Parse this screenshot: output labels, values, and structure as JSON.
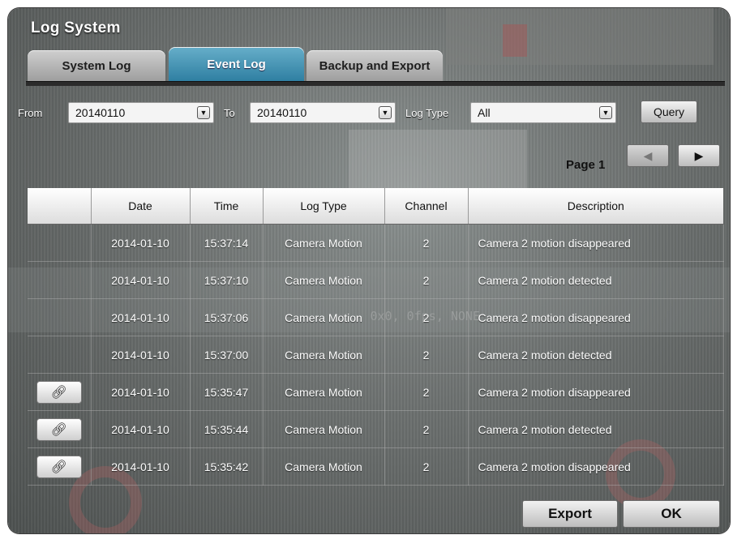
{
  "window": {
    "title": "Log System"
  },
  "tabs": [
    {
      "label": "System Log",
      "active": false
    },
    {
      "label": "Event Log",
      "active": true
    },
    {
      "label": "Backup and Export",
      "active": false
    }
  ],
  "filters": {
    "from_label": "From",
    "from_value": "20140110",
    "to_label": "To",
    "to_value": "20140110",
    "logtype_label": "Log Type",
    "logtype_value": "All",
    "query_label": "Query"
  },
  "pagination": {
    "page_label": "Page 1",
    "prev_icon": "arrow-left-icon",
    "next_icon": "arrow-right-icon"
  },
  "table": {
    "columns": [
      "",
      "Date",
      "Time",
      "Log Type",
      "Channel",
      "Description"
    ],
    "rows": [
      {
        "has_link": false,
        "date": "2014-01-10",
        "time": "15:37:14",
        "type": "Camera Motion",
        "channel": "2",
        "description": "Camera 2 motion disappeared"
      },
      {
        "has_link": false,
        "date": "2014-01-10",
        "time": "15:37:10",
        "type": "Camera Motion",
        "channel": "2",
        "description": "Camera 2 motion detected"
      },
      {
        "has_link": false,
        "date": "2014-01-10",
        "time": "15:37:06",
        "type": "Camera Motion",
        "channel": "2",
        "description": "Camera 2 motion disappeared"
      },
      {
        "has_link": false,
        "date": "2014-01-10",
        "time": "15:37:00",
        "type": "Camera Motion",
        "channel": "2",
        "description": "Camera 2 motion detected"
      },
      {
        "has_link": true,
        "date": "2014-01-10",
        "time": "15:35:47",
        "type": "Camera Motion",
        "channel": "2",
        "description": "Camera 2 motion disappeared"
      },
      {
        "has_link": true,
        "date": "2014-01-10",
        "time": "15:35:44",
        "type": "Camera Motion",
        "channel": "2",
        "description": "Camera 2 motion detected"
      },
      {
        "has_link": true,
        "date": "2014-01-10",
        "time": "15:35:42",
        "type": "Camera Motion",
        "channel": "2",
        "description": "Camera 2 motion disappeared"
      }
    ]
  },
  "footer": {
    "export_label": "Export",
    "ok_label": "OK"
  },
  "overlay": {
    "watermark": "0x0, 0fps, NONE"
  },
  "icons": {
    "link": "link-icon",
    "dropdown": "chevron-down-icon"
  },
  "colors": {
    "active_tab": "#3f8fb2",
    "header_bg": "#ffffff"
  }
}
